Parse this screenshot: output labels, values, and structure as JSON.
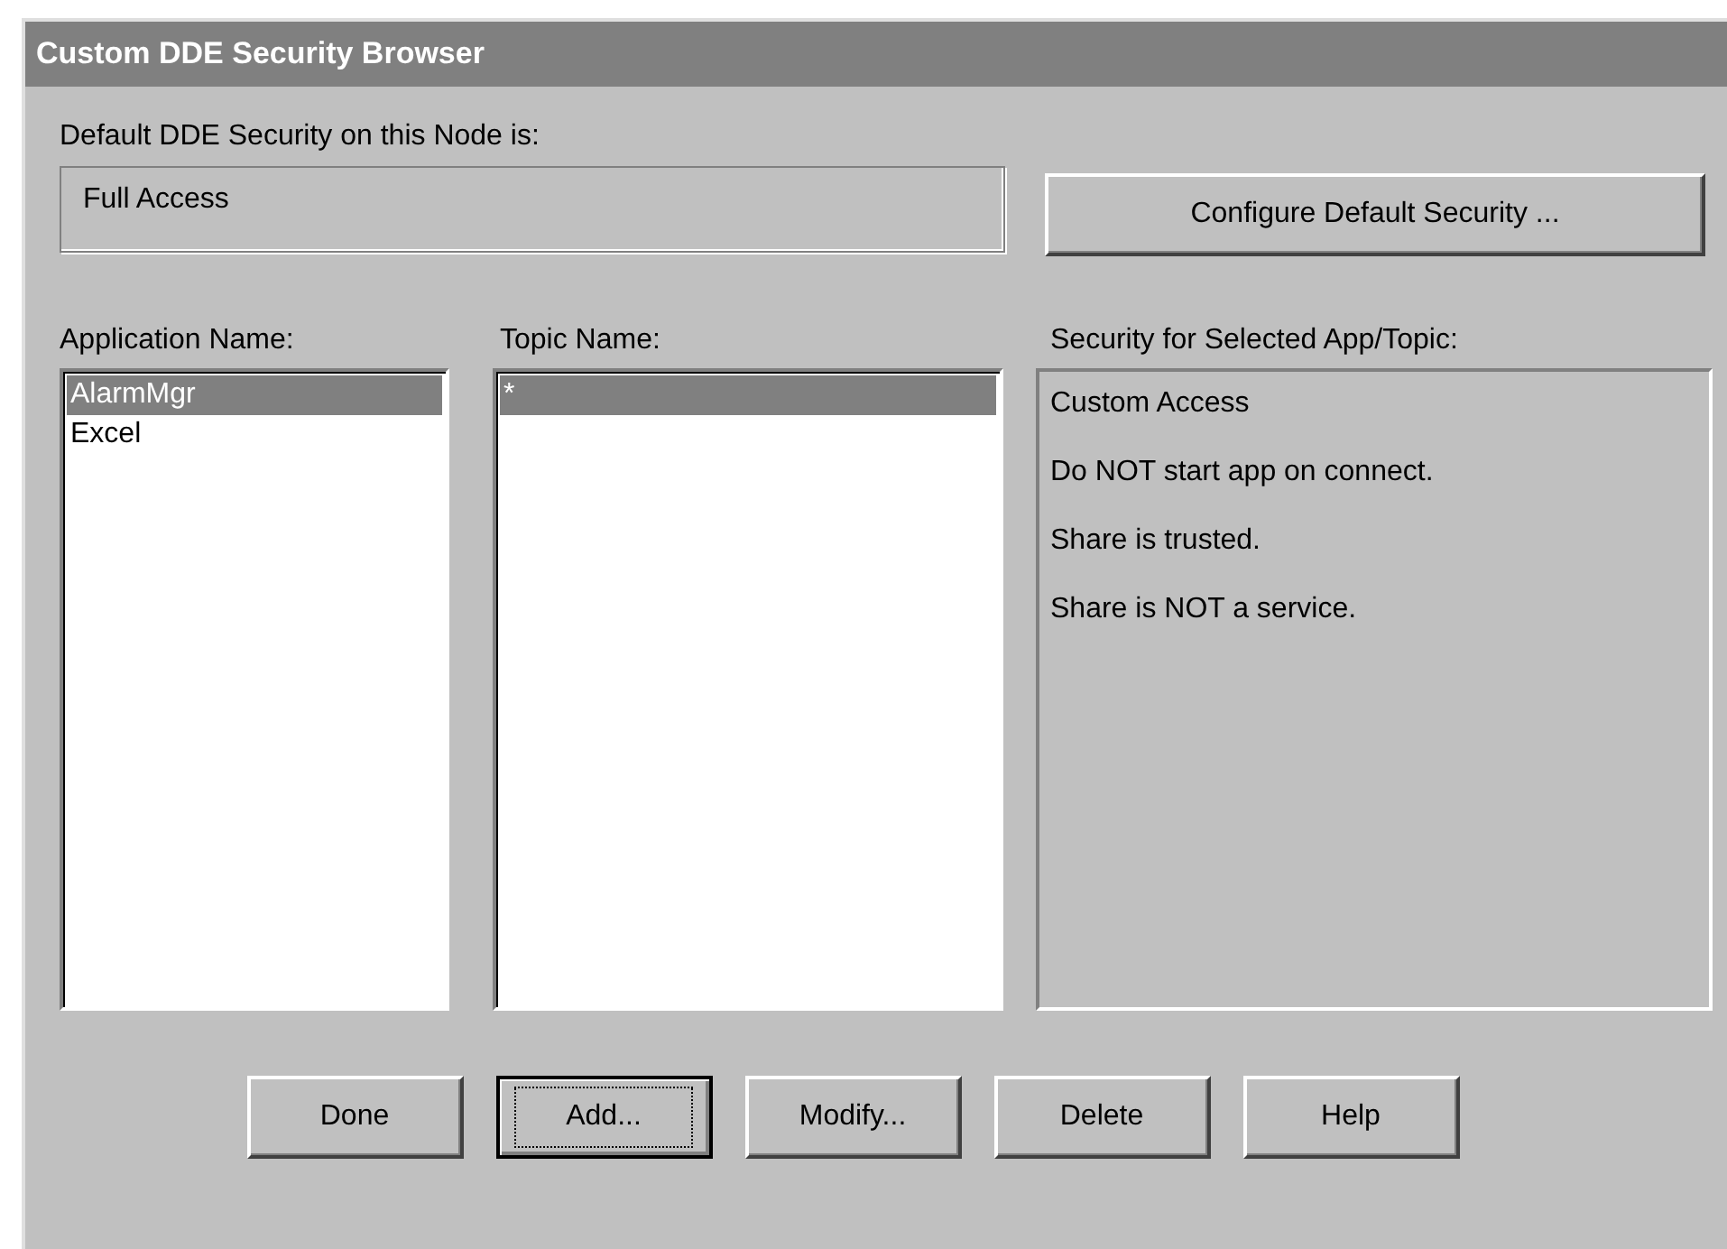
{
  "window": {
    "title": "Custom DDE Security Browser"
  },
  "default_security": {
    "label": "Default DDE Security on this Node is:",
    "value": "Full Access"
  },
  "configure_button": {
    "label": "Configure Default Security ..."
  },
  "application_list": {
    "label": "Application Name:",
    "items": [
      {
        "text": "AlarmMgr",
        "selected": true
      },
      {
        "text": "Excel",
        "selected": false
      }
    ]
  },
  "topic_list": {
    "label": "Topic Name:",
    "items": [
      {
        "text": "*",
        "selected": true
      }
    ]
  },
  "security_panel": {
    "label": "Security for Selected App/Topic:",
    "lines": [
      "Custom Access",
      "Do NOT start app on connect.",
      "Share is trusted.",
      "Share is NOT a service."
    ]
  },
  "buttons": [
    {
      "label": "Done",
      "focused": false
    },
    {
      "label": "Add...",
      "focused": true
    },
    {
      "label": "Modify...",
      "focused": false
    },
    {
      "label": "Delete",
      "focused": false
    },
    {
      "label": "Help",
      "focused": false
    }
  ]
}
